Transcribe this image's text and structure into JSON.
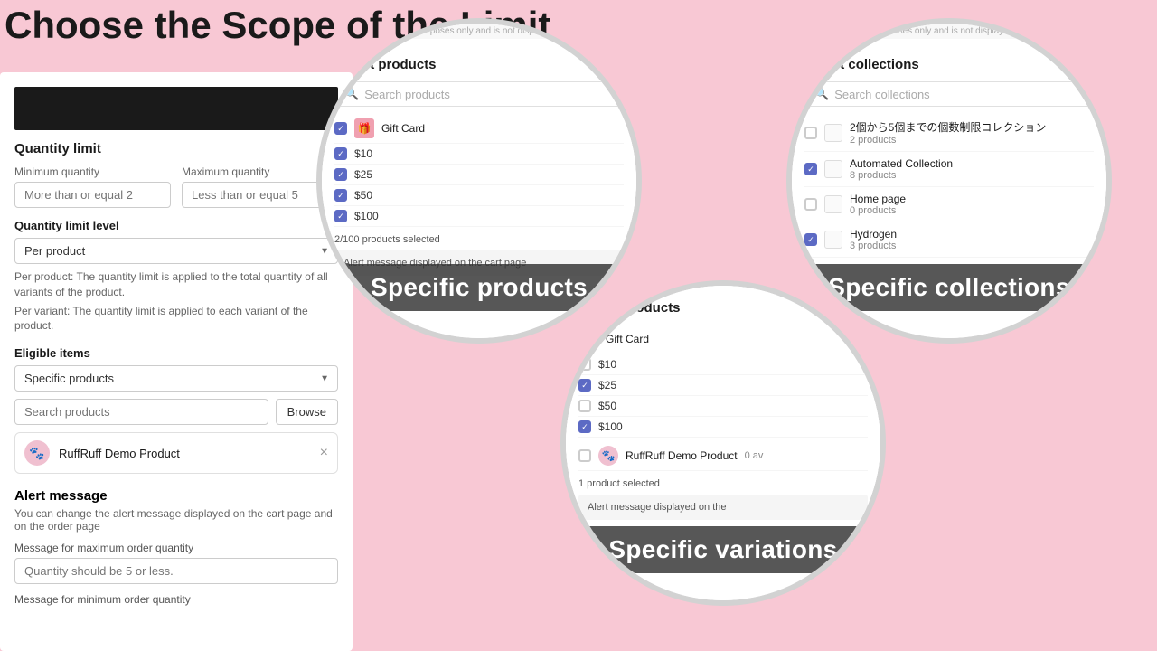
{
  "title": "Choose the Scope of the Limit",
  "leftPanel": {
    "quantityLimitTitle": "Quantity limit",
    "minQtyLabel": "Minimum quantity",
    "minQtyValue": "More than or equal 2",
    "maxQtyLabel": "Maximum quantity",
    "maxQtyValue": "Less than or equal 5",
    "qtyLimitLevelLabel": "Quantity limit level",
    "qtyLimitLevelValue": "Per product",
    "helpText1": "Per product: The quantity limit is applied to the total quantity of all variants of the product.",
    "helpText2": "Per variant: The quantity limit is applied to each variant of the product.",
    "eligibleItemsTitle": "Eligible items",
    "eligibleDropdownValue": "Specific products",
    "searchPlaceholder": "Search products",
    "browseBtn": "Browse",
    "productName": "RuffRuff Demo Product",
    "alertTitle": "Alert message",
    "alertDesc": "You can change the alert message displayed on the cart page and on the order page",
    "maxMsgLabel": "Message for maximum order quantity",
    "maxMsgValue": "Quantity should be 5 or less.",
    "minMsgLabel": "Message for minimum order quantity"
  },
  "circleProducts": {
    "infoBarText": "rative purposes only and is not displayed to",
    "panelTitle": "Select products",
    "searchPlaceholder": "Search products",
    "giftCardName": "Gift Card",
    "variants": [
      "$10",
      "$25",
      "$50",
      "$100"
    ],
    "checkedVariants": [
      "$10",
      "$25",
      "$50",
      "$100"
    ],
    "footerText": "2/100 products selected",
    "alertBarText": "Alert message displayed on the cart page",
    "label": "Specific products"
  },
  "circleCollections": {
    "infoBarText": "rative purposes only and is not displayed to custo",
    "panelTitle": "Select collections",
    "searchPlaceholder": "Search collections",
    "collections": [
      {
        "name": "2個から5個までの個数制限コレクション",
        "count": "2 products",
        "checked": false
      },
      {
        "name": "Automated Collection",
        "count": "8 products",
        "checked": true
      },
      {
        "name": "Home page",
        "count": "0 products",
        "checked": false
      },
      {
        "name": "Hydrogen",
        "count": "3 products",
        "checked": true
      }
    ],
    "label": "Specific collections"
  },
  "circleVariations": {
    "panelTitle": "Select products",
    "giftCardName": "Gift Card",
    "variants": [
      {
        "name": "$10",
        "checked": false
      },
      {
        "name": "$25",
        "checked": true
      },
      {
        "name": "$50",
        "checked": false
      },
      {
        "name": "$100",
        "checked": true
      }
    ],
    "demoProduct": "RuffRuff Demo Product",
    "demoAvail": "0 av",
    "footerText": "1 product selected",
    "alertBarText": "Alert message displayed on the",
    "label": "Specific variations"
  },
  "icons": {
    "search": "🔍",
    "check": "✓",
    "close": "×",
    "paw": "🐾",
    "gift": "🎁"
  }
}
